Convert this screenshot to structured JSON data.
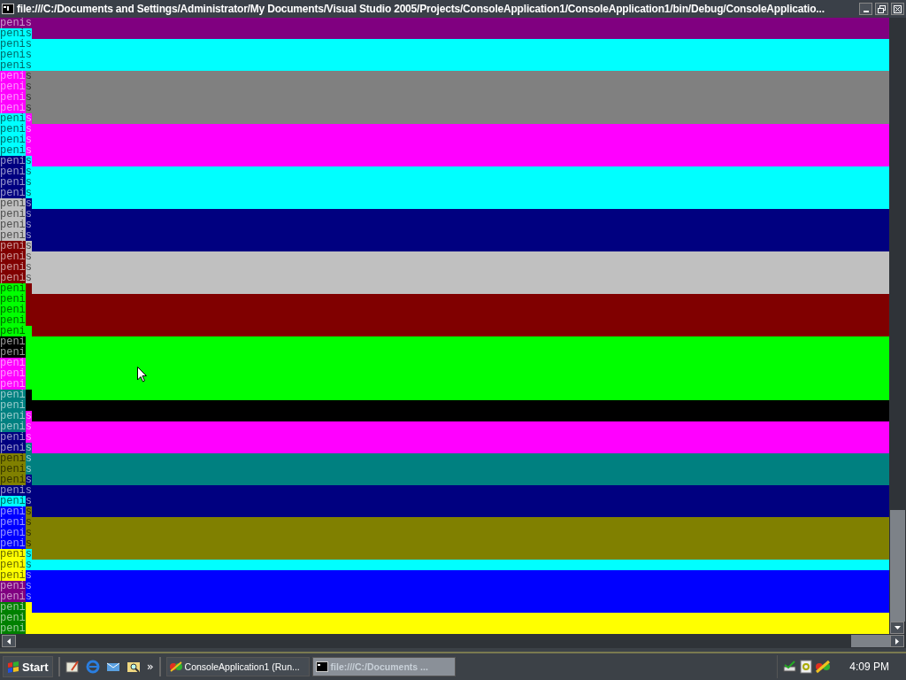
{
  "window": {
    "title": "file:///C:/Documents and Settings/Administrator/My Documents/Visual Studio 2005/Projects/ConsoleApplication1/ConsoleApplication1/bin/Debug/ConsoleApplicatio..."
  },
  "console": {
    "lines": [
      {
        "cells": [
          {
            "text": "penis",
            "color": "#800080"
          }
        ],
        "color": "#800080"
      },
      {
        "cells": [
          {
            "text": "penis",
            "color": "#00ffff"
          }
        ],
        "color": "#800080"
      },
      {
        "cells": [
          {
            "text": "penis",
            "color": "#00ffff"
          }
        ],
        "color": "#00ffff"
      },
      {
        "cells": [
          {
            "text": "penis",
            "color": "#00ffff"
          }
        ],
        "color": "#00ffff"
      },
      {
        "cells": [
          {
            "text": "penis",
            "color": "#00ffff"
          }
        ],
        "color": "#00ffff"
      },
      {
        "cells": [
          {
            "text": "peni",
            "color": "#ff00ff"
          },
          {
            "text": "s",
            "color": "#808080"
          }
        ],
        "color": "#808080"
      },
      {
        "cells": [
          {
            "text": "peni",
            "color": "#ff00ff"
          },
          {
            "text": "s",
            "color": "#808080"
          }
        ],
        "color": "#808080"
      },
      {
        "cells": [
          {
            "text": "peni",
            "color": "#ff00ff"
          },
          {
            "text": "s",
            "color": "#808080"
          }
        ],
        "color": "#808080"
      },
      {
        "cells": [
          {
            "text": "peni",
            "color": "#ff00ff"
          },
          {
            "text": "s",
            "color": "#808080"
          }
        ],
        "color": "#808080"
      },
      {
        "cells": [
          {
            "text": "peni",
            "color": "#00ffff"
          },
          {
            "text": "s",
            "color": "#ff00ff"
          }
        ],
        "color": "#808080"
      },
      {
        "cells": [
          {
            "text": "peni",
            "color": "#00ffff"
          },
          {
            "text": "s",
            "color": "#ff00ff"
          }
        ],
        "color": "#ff00ff"
      },
      {
        "cells": [
          {
            "text": "peni",
            "color": "#00ffff"
          },
          {
            "text": "s",
            "color": "#ff00ff"
          }
        ],
        "color": "#ff00ff"
      },
      {
        "cells": [
          {
            "text": "peni",
            "color": "#00ffff"
          },
          {
            "text": "s",
            "color": "#ff00ff"
          }
        ],
        "color": "#ff00ff"
      },
      {
        "cells": [
          {
            "text": "peni",
            "color": "#000080"
          },
          {
            "text": "s",
            "color": "#00ffff"
          }
        ],
        "color": "#ff00ff"
      },
      {
        "cells": [
          {
            "text": "peni",
            "color": "#000080"
          },
          {
            "text": "s",
            "color": "#00ffff"
          }
        ],
        "color": "#00ffff"
      },
      {
        "cells": [
          {
            "text": "peni",
            "color": "#000080"
          },
          {
            "text": "s",
            "color": "#00ffff"
          }
        ],
        "color": "#00ffff"
      },
      {
        "cells": [
          {
            "text": "peni",
            "color": "#000080"
          },
          {
            "text": "s",
            "color": "#00ffff"
          }
        ],
        "color": "#00ffff"
      },
      {
        "cells": [
          {
            "text": "peni",
            "color": "#c0c0c0"
          },
          {
            "text": "s",
            "color": "#000080"
          }
        ],
        "color": "#00ffff"
      },
      {
        "cells": [
          {
            "text": "peni",
            "color": "#c0c0c0"
          },
          {
            "text": "s",
            "color": "#000080"
          }
        ],
        "color": "#000080"
      },
      {
        "cells": [
          {
            "text": "peni",
            "color": "#c0c0c0"
          },
          {
            "text": "s",
            "color": "#000080"
          }
        ],
        "color": "#000080"
      },
      {
        "cells": [
          {
            "text": "peni",
            "color": "#c0c0c0"
          },
          {
            "text": "s",
            "color": "#000080"
          }
        ],
        "color": "#000080"
      },
      {
        "cells": [
          {
            "text": "peni",
            "color": "#800000"
          },
          {
            "text": "s",
            "color": "#c0c0c0"
          }
        ],
        "color": "#000080"
      },
      {
        "cells": [
          {
            "text": "peni",
            "color": "#800000"
          },
          {
            "text": "s",
            "color": "#c0c0c0"
          }
        ],
        "color": "#c0c0c0"
      },
      {
        "cells": [
          {
            "text": "peni",
            "color": "#800000"
          },
          {
            "text": "s",
            "color": "#c0c0c0"
          }
        ],
        "color": "#c0c0c0"
      },
      {
        "cells": [
          {
            "text": "peni",
            "color": "#800000"
          },
          {
            "text": "s",
            "color": "#c0c0c0"
          }
        ],
        "color": "#c0c0c0"
      },
      {
        "cells": [
          {
            "text": "peni",
            "color": "#00ff00"
          },
          {
            "color": "#800000"
          }
        ],
        "color": "#c0c0c0"
      },
      {
        "cells": [
          {
            "text": "peni",
            "color": "#00ff00"
          }
        ],
        "color": "#800000"
      },
      {
        "cells": [
          {
            "text": "peni",
            "color": "#00ff00"
          }
        ],
        "color": "#800000"
      },
      {
        "cells": [
          {
            "text": "peni",
            "color": "#00ff00"
          }
        ],
        "color": "#800000"
      },
      {
        "cells": [
          {
            "text": "peni",
            "color": "#00ff00"
          },
          {
            "color": "#00ff00"
          }
        ],
        "color": "#800000"
      },
      {
        "cells": [
          {
            "text": "peni",
            "color": "#000000"
          }
        ],
        "color": "#00ff00"
      },
      {
        "cells": [
          {
            "text": "peni",
            "color": "#000000"
          }
        ],
        "color": "#00ff00"
      },
      {
        "cells": [
          {
            "text": "peni",
            "color": "#ff00ff"
          }
        ],
        "color": "#00ff00"
      },
      {
        "cells": [
          {
            "text": "peni",
            "color": "#ff00ff"
          }
        ],
        "color": "#00ff00"
      },
      {
        "cells": [
          {
            "text": "peni",
            "color": "#ff00ff"
          }
        ],
        "color": "#00ff00"
      },
      {
        "cells": [
          {
            "text": "peni",
            "color": "#008080"
          },
          {
            "color": "#000000"
          }
        ],
        "color": "#00ff00"
      },
      {
        "cells": [
          {
            "text": "peni",
            "color": "#008080"
          }
        ],
        "color": "#000000"
      },
      {
        "cells": [
          {
            "text": "peni",
            "color": "#008080"
          },
          {
            "text": "s",
            "color": "#ff00ff"
          }
        ],
        "color": "#000000"
      },
      {
        "cells": [
          {
            "text": "peni",
            "color": "#008080"
          },
          {
            "text": "s",
            "color": "#ff00ff"
          }
        ],
        "color": "#ff00ff"
      },
      {
        "cells": [
          {
            "text": "peni",
            "color": "#000080"
          },
          {
            "text": "s",
            "color": "#ff00ff"
          }
        ],
        "color": "#ff00ff"
      },
      {
        "cells": [
          {
            "text": "peni",
            "color": "#000080"
          },
          {
            "text": "s",
            "color": "#008080"
          }
        ],
        "color": "#ff00ff"
      },
      {
        "cells": [
          {
            "text": "peni",
            "color": "#808000"
          },
          {
            "text": "s",
            "color": "#008080"
          }
        ],
        "color": "#008080"
      },
      {
        "cells": [
          {
            "text": "peni",
            "color": "#808000"
          },
          {
            "text": "s",
            "color": "#008080"
          }
        ],
        "color": "#008080"
      },
      {
        "cells": [
          {
            "text": "peni",
            "color": "#808000"
          },
          {
            "text": "s",
            "color": "#000080"
          }
        ],
        "color": "#008080"
      },
      {
        "cells": [
          {
            "text": "peni",
            "color": "#000080"
          },
          {
            "text": "s",
            "color": "#000080"
          }
        ],
        "color": "#000080"
      },
      {
        "cells": [
          {
            "text": "peni",
            "color": "#00ffff"
          },
          {
            "text": "s",
            "color": "#000080"
          }
        ],
        "color": "#000080"
      },
      {
        "cells": [
          {
            "text": "peni",
            "color": "#0000ff"
          },
          {
            "text": "s",
            "color": "#808000"
          }
        ],
        "color": "#000080"
      },
      {
        "cells": [
          {
            "text": "peni",
            "color": "#0000ff"
          },
          {
            "text": "s",
            "color": "#808000"
          }
        ],
        "color": "#808000"
      },
      {
        "cells": [
          {
            "text": "peni",
            "color": "#0000ff"
          },
          {
            "text": "s",
            "color": "#808000"
          }
        ],
        "color": "#808000"
      },
      {
        "cells": [
          {
            "text": "peni",
            "color": "#0000ff"
          },
          {
            "text": "s",
            "color": "#808000"
          }
        ],
        "color": "#808000"
      },
      {
        "cells": [
          {
            "text": "peni",
            "color": "#ffff00"
          },
          {
            "text": "s",
            "color": "#00ffff"
          }
        ],
        "color": "#808000"
      },
      {
        "cells": [
          {
            "text": "peni",
            "color": "#ffff00"
          },
          {
            "text": "s",
            "color": "#00ffff"
          }
        ],
        "color": "#00ffff"
      },
      {
        "cells": [
          {
            "text": "peni",
            "color": "#ffff00"
          },
          {
            "text": "s",
            "color": "#0000ff"
          }
        ],
        "color": "#0000ff"
      },
      {
        "cells": [
          {
            "text": "peni",
            "color": "#800080"
          },
          {
            "text": "s",
            "color": "#0000ff"
          }
        ],
        "color": "#0000ff"
      },
      {
        "cells": [
          {
            "text": "peni",
            "color": "#800080"
          },
          {
            "text": "s",
            "color": "#0000ff"
          }
        ],
        "color": "#0000ff"
      },
      {
        "cells": [
          {
            "text": "peni",
            "color": "#008000"
          },
          {
            "color": "#ffff00"
          }
        ],
        "color": "#0000ff"
      },
      {
        "cells": [
          {
            "text": "peni",
            "color": "#008000"
          }
        ],
        "color": "#ffff00"
      },
      {
        "cells": [
          {
            "text": "peni",
            "color": "#008000"
          }
        ],
        "color": "#ffff00"
      }
    ]
  },
  "taskbar": {
    "start": "Start",
    "more": "»",
    "tasks": [
      {
        "label": "ConsoleApplication1 (Run...",
        "selected": false
      },
      {
        "label": "file:///C:/Documents ...",
        "selected": true
      }
    ],
    "clock": "4:09 PM"
  }
}
